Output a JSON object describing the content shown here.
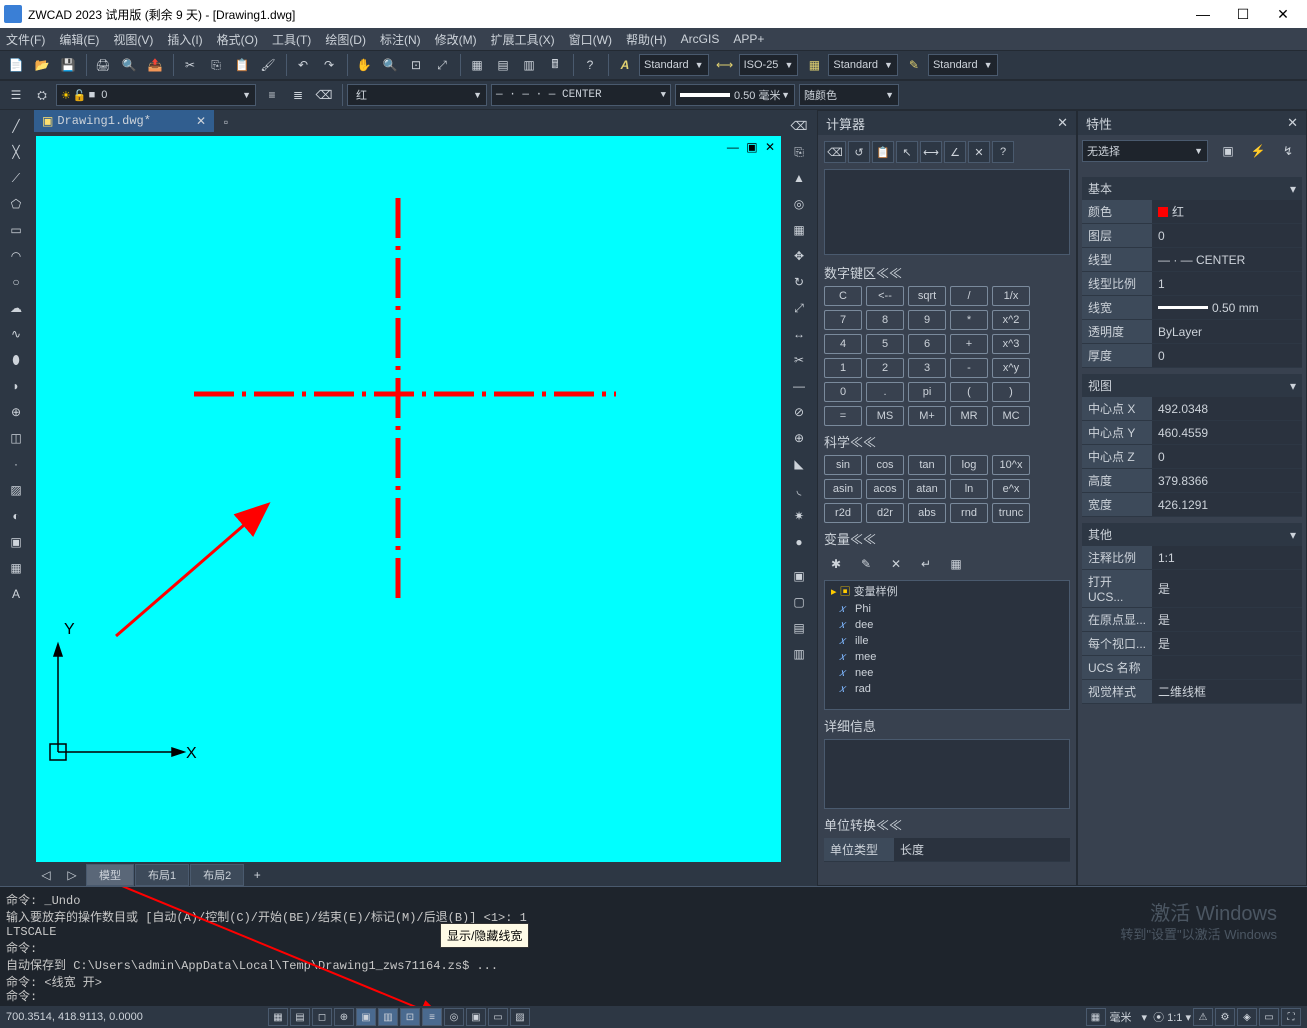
{
  "title": "ZWCAD 2023 试用版 (剩余 9 天) - [Drawing1.dwg]",
  "menu": [
    "文件(F)",
    "编辑(E)",
    "视图(V)",
    "插入(I)",
    "格式(O)",
    "工具(T)",
    "绘图(D)",
    "标注(N)",
    "修改(M)",
    "扩展工具(X)",
    "窗口(W)",
    "帮助(H)",
    "ArcGIS",
    "APP+"
  ],
  "styleCombos": {
    "textstyle": "Standard",
    "dimstyle": "ISO-25",
    "tablestyle": "Standard",
    "mleader": "Standard"
  },
  "layer": {
    "name": "0"
  },
  "color": "红",
  "linetype": "— · — · — CENTER",
  "lineweight": "0.50 毫米",
  "plotcolor": "随颜色",
  "filetab": "Drawing1.dwg*",
  "bottomTabs": [
    "模型",
    "布局1",
    "布局2"
  ],
  "calc": {
    "title": "计算器",
    "s_numpad": "数字键区≪≪",
    "pad": [
      [
        "C",
        "<--",
        "sqrt",
        "/",
        "1/x"
      ],
      [
        "7",
        "8",
        "9",
        "*",
        "x^2"
      ],
      [
        "4",
        "5",
        "6",
        "+",
        "x^3"
      ],
      [
        "1",
        "2",
        "3",
        "-",
        "x^y"
      ],
      [
        "0",
        ".",
        "pi",
        "(",
        ")"
      ],
      [
        "=",
        "MS",
        "M+",
        "MR",
        "MC"
      ]
    ],
    "s_sci": "科学≪≪",
    "sci": [
      [
        "sin",
        "cos",
        "tan",
        "log",
        "10^x"
      ],
      [
        "asin",
        "acos",
        "atan",
        "ln",
        "e^x"
      ],
      [
        "r2d",
        "d2r",
        "abs",
        "rnd",
        "trunc"
      ]
    ],
    "s_var": "变量≪≪",
    "varroot": "变量样例",
    "vars": [
      "Phi",
      "dee",
      "ille",
      "mee",
      "nee",
      "rad"
    ],
    "s_detail": "详细信息",
    "s_convert": "单位转换≪≪",
    "convert_type_label": "单位类型",
    "convert_type": "长度"
  },
  "props": {
    "title": "特性",
    "noSel": "无选择",
    "g_basic": "基本",
    "rows_basic": [
      {
        "k": "颜色",
        "v": "红",
        "sw": "#ff0000"
      },
      {
        "k": "图层",
        "v": "0"
      },
      {
        "k": "线型",
        "v": "— · — CENTER"
      },
      {
        "k": "线型比例",
        "v": "1"
      },
      {
        "k": "线宽",
        "v": "0.50 mm",
        "lw": true
      },
      {
        "k": "透明度",
        "v": "ByLayer"
      },
      {
        "k": "厚度",
        "v": "0"
      }
    ],
    "g_view": "视图",
    "rows_view": [
      {
        "k": "中心点 X",
        "v": "492.0348"
      },
      {
        "k": "中心点 Y",
        "v": "460.4559"
      },
      {
        "k": "中心点 Z",
        "v": "0"
      },
      {
        "k": "高度",
        "v": "379.8366"
      },
      {
        "k": "宽度",
        "v": "426.1291"
      }
    ],
    "g_other": "其他",
    "rows_other": [
      {
        "k": "注释比例",
        "v": "1:1"
      },
      {
        "k": "打开 UCS...",
        "v": "是"
      },
      {
        "k": "在原点显...",
        "v": "是"
      },
      {
        "k": "每个视口...",
        "v": "是"
      },
      {
        "k": "UCS 名称",
        "v": ""
      },
      {
        "k": "视觉样式",
        "v": "二维线框"
      }
    ]
  },
  "cmd": {
    "lines": [
      "命令: _Undo",
      "输入要放弃的操作数目或 [自动(A)/控制(C)/开始(BE)/结束(E)/标记(M)/后退(B)] <1>: 1",
      "LTSCALE",
      "命令:",
      "自动保存到 C:\\Users\\admin\\AppData\\Local\\Temp\\Drawing1_zws71164.zs$ ...",
      "命令:  <线宽 开>"
    ],
    "prompt": "命令:"
  },
  "tooltip": "显示/隐藏线宽",
  "status": {
    "coords": "700.3514, 418.9113, 0.0000",
    "scale": "1:1",
    "lw": "毫米"
  },
  "activate": {
    "l1": "激活 Windows",
    "l2": "转到\"设置\"以激活 Windows"
  }
}
